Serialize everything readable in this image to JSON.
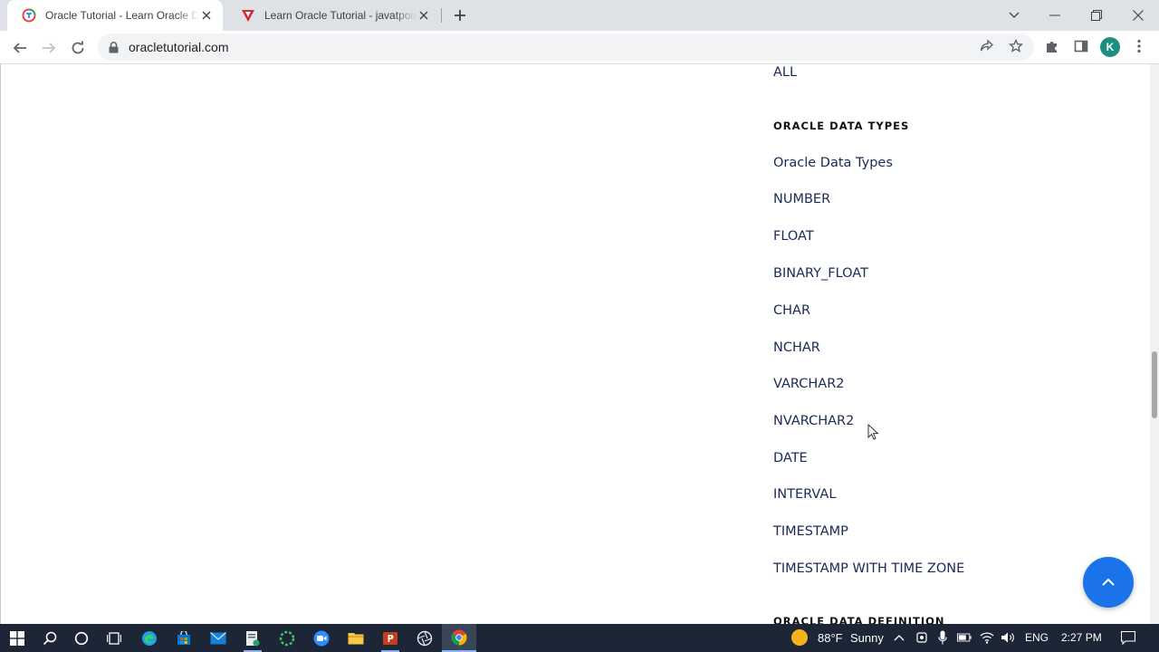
{
  "browser": {
    "tabs": [
      {
        "title": "Oracle Tutorial - Learn Oracle Database from Scratch",
        "active": true
      },
      {
        "title": "Learn Oracle Tutorial - javatpoint",
        "active": false
      }
    ],
    "url": "oracletutorial.com",
    "profile_initial": "K"
  },
  "sidebar": {
    "top_link": "ALL",
    "section_heading": "ORACLE DATA TYPES",
    "items": [
      "Oracle Data Types",
      "NUMBER",
      "FLOAT",
      "BINARY_FLOAT",
      "CHAR",
      "NCHAR",
      "VARCHAR2",
      "NVARCHAR2",
      "DATE",
      "INTERVAL",
      "TIMESTAMP",
      "TIMESTAMP WITH TIME ZONE"
    ],
    "next_heading": "ORACLE DATA DEFINITION"
  },
  "taskbar": {
    "weather_temp": "88°F",
    "weather_text": "Sunny",
    "language": "ENG",
    "time": "2:27 PM"
  },
  "colors": {
    "link": "#1b2a57",
    "accent": "#1a73e8",
    "taskbar": "#1c2636"
  }
}
